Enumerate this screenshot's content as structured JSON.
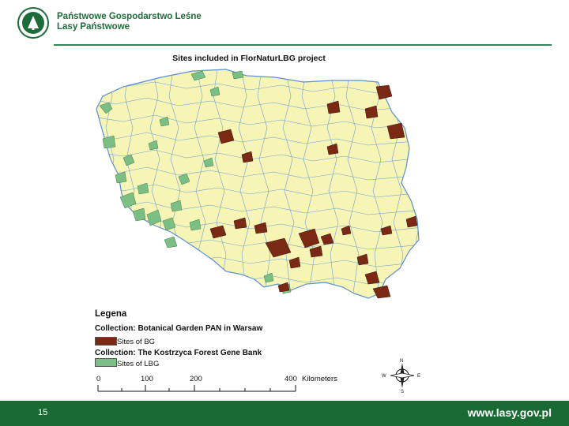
{
  "header": {
    "org_line1": "Państwowe Gospodarstwo Leśne",
    "org_line2": "Lasy Państwowe",
    "logo_text": "LASY PAŃSTWOWE"
  },
  "map": {
    "title": "Sites included in FlorNaturLBG project",
    "colors": {
      "land": "#f6f5b5",
      "border": "#5a8fd0",
      "bg_sites": "#7a2a14",
      "lbg_sites": "#7cbf84"
    }
  },
  "legend": {
    "title": "Legena",
    "collection1": "Collection: Botanical Garden PAN in Warsaw",
    "collection1_item": "Sites of BG",
    "collection2": "Collection: The Kostrzyca Forest Gene Bank",
    "collection2_item": "Sites of LBG"
  },
  "scale": {
    "ticks": [
      "0",
      "100",
      "200",
      "400"
    ],
    "unit": "Kilometers"
  },
  "compass": {
    "n": "N",
    "s": "S",
    "e": "E",
    "w": "W"
  },
  "footer": {
    "page_number": "15",
    "url": "www.lasy.gov.pl"
  }
}
